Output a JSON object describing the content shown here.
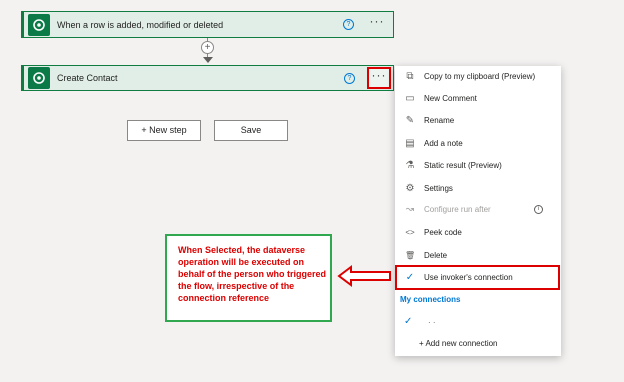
{
  "flow": {
    "trigger_title": "When a row is added, modified or deleted",
    "action_title": "Create Contact",
    "help_glyph": "?",
    "more_glyph": "···",
    "plus_glyph": "+"
  },
  "buttons": {
    "new_step": "+ New step",
    "save": "Save"
  },
  "menu": {
    "items": [
      {
        "label": "Copy to my clipboard (Preview)",
        "icon": "copy-icon",
        "glyph": "⧉"
      },
      {
        "label": "New Comment",
        "icon": "comment-icon",
        "glyph": "▭"
      },
      {
        "label": "Rename",
        "icon": "pencil-icon",
        "glyph": "✎"
      },
      {
        "label": "Add a note",
        "icon": "note-icon",
        "glyph": "▤"
      },
      {
        "label": "Static result (Preview)",
        "icon": "flask-icon",
        "glyph": "⚗"
      },
      {
        "label": "Settings",
        "icon": "gear-icon",
        "glyph": "⚙"
      },
      {
        "label": "Configure run after",
        "icon": "run-after-icon",
        "glyph": "↝"
      },
      {
        "label": "Peek code",
        "icon": "code-icon",
        "glyph": "<>"
      },
      {
        "label": "Delete",
        "icon": "trash-icon",
        "glyph": "🗑"
      },
      {
        "label": "Use invoker's connection",
        "icon": "check-icon",
        "glyph": "✓"
      }
    ],
    "info_glyph": "i",
    "my_connections": "My connections",
    "check_glyph": "✓",
    "connection_dots": "· ·",
    "add_new_connection": "+ Add new connection"
  },
  "callout": {
    "text": "When Selected, the dataverse operation will be executed on behalf of the person who triggered the flow, irrespective of the connection reference"
  },
  "colors": {
    "accent_green": "#107c41",
    "highlight_red": "#dd0000",
    "link_blue": "#0078d4"
  }
}
